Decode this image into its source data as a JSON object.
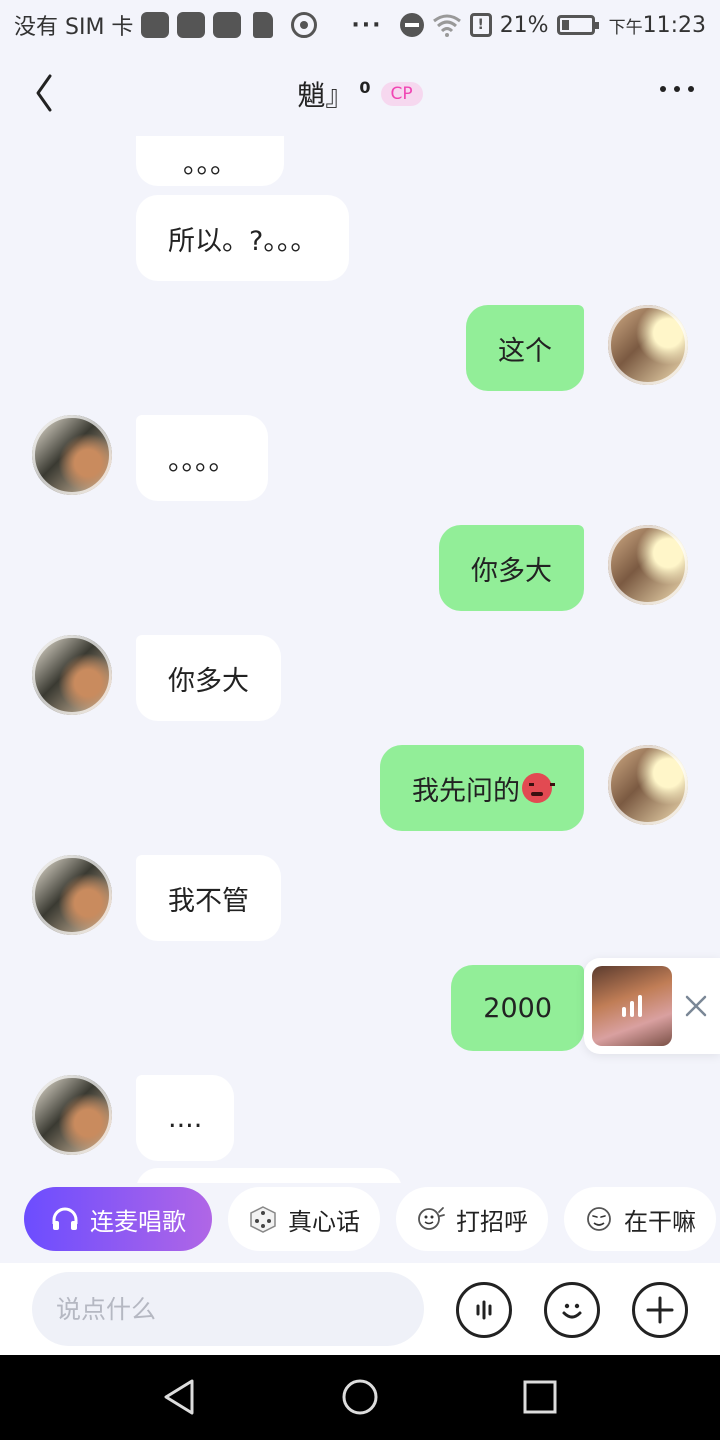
{
  "status_bar": {
    "carrier": "没有 SIM 卡",
    "more": "···",
    "battery_percent": "21%",
    "time_prefix": "下午",
    "time": "11:23",
    "icons": [
      "app-icon",
      "app-icon",
      "app-icon",
      "sd-card-icon",
      "cast-icon",
      "dnd-icon",
      "wifi-icon",
      "alert-icon",
      "battery-icon"
    ]
  },
  "header": {
    "back_icon": "chevron-left-icon",
    "title": "魈』",
    "title_sup": "0",
    "badge": "CP",
    "more_icon": "more-dots-icon"
  },
  "messages": [
    {
      "side": "in",
      "text": "。。。",
      "partial": true
    },
    {
      "side": "in",
      "text": "所以。?。。。"
    },
    {
      "side": "out",
      "text": "这个"
    },
    {
      "side": "in",
      "text": "。。。。"
    },
    {
      "side": "out",
      "text": "你多大"
    },
    {
      "side": "in",
      "text": "你多大"
    },
    {
      "side": "out",
      "text": "我先问的",
      "emoji": "angry-face-icon"
    },
    {
      "side": "in",
      "text": "我不管"
    },
    {
      "side": "out",
      "text": "2000"
    },
    {
      "side": "in",
      "text": "...."
    }
  ],
  "music_float": {
    "cover_icon": "music-cover",
    "playing_icon": "sound-bars-icon",
    "close_icon": "close-icon"
  },
  "chips": [
    {
      "label": "连麦唱歌",
      "icon": "headphones-icon",
      "primary": true
    },
    {
      "label": "真心话",
      "icon": "dice-icon"
    },
    {
      "label": "打招呼",
      "icon": "wave-emoji-icon"
    },
    {
      "label": "在干嘛",
      "icon": "curious-emoji-icon"
    }
  ],
  "input": {
    "placeholder": "说点什么",
    "value": ""
  },
  "input_buttons": [
    "voice-icon",
    "emoji-icon",
    "plus-icon"
  ],
  "nav": [
    "back-triangle-icon",
    "home-circle-icon",
    "recents-square-icon"
  ],
  "colors": {
    "background": "#f3f4fb",
    "outgoing_bubble": "#92ee98",
    "incoming_bubble": "#ffffff",
    "badge_text": "#f045b3",
    "badge_bg": "#f6d8ef",
    "primary_chip_start": "#6c4dff",
    "primary_chip_end": "#b066e6"
  }
}
